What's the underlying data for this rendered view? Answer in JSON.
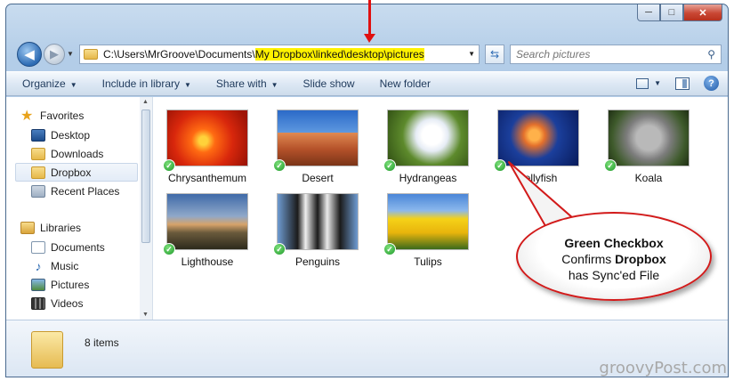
{
  "window": {
    "caption_minimize": "─",
    "caption_maximize": "□",
    "caption_close": "✕"
  },
  "address_bar": {
    "path_prefix": "C:\\Users\\MrGroove\\Documents\\",
    "path_highlight": "My Dropbox\\linked\\desktop\\pictures"
  },
  "search": {
    "placeholder": "Search pictures"
  },
  "toolbar": {
    "organize": "Organize",
    "include_in_library": "Include in library",
    "share_with": "Share with",
    "slide_show": "Slide show",
    "new_folder": "New folder",
    "help": "?"
  },
  "nav_pane": {
    "favorites": "Favorites",
    "favorites_items": [
      "Desktop",
      "Downloads",
      "Dropbox",
      "Recent Places"
    ],
    "libraries": "Libraries",
    "libraries_items": [
      "Documents",
      "Music",
      "Pictures",
      "Videos"
    ]
  },
  "files": [
    {
      "name": "Chrysanthemum",
      "synced": true
    },
    {
      "name": "Desert",
      "synced": true
    },
    {
      "name": "Hydrangeas",
      "synced": true
    },
    {
      "name": "Jellyfish",
      "synced": true
    },
    {
      "name": "Koala",
      "synced": true
    },
    {
      "name": "Lighthouse",
      "synced": true
    },
    {
      "name": "Penguins",
      "synced": true
    },
    {
      "name": "Tulips",
      "synced": true
    }
  ],
  "details": {
    "item_count": "8 items"
  },
  "callout": {
    "line1": "Green Checkbox",
    "line2_a": "Confirms ",
    "line2_b": "Dropbox",
    "line3": "has Sync'ed File"
  },
  "watermark": "groovyPost.com",
  "colors": {
    "accent": "#2d6bb3",
    "highlight": "#fff200",
    "sync_green": "#1e9a2a",
    "annotation_red": "#e01010"
  }
}
